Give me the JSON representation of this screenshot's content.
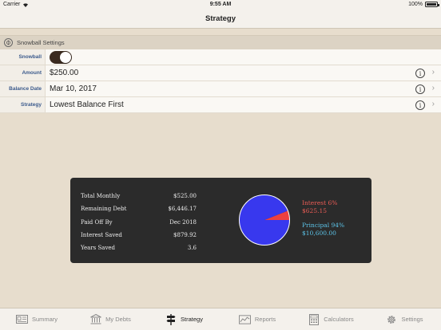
{
  "status_bar": {
    "carrier": "Carrier",
    "time": "9:55 AM",
    "battery": "100%"
  },
  "nav": {
    "title": "Strategy"
  },
  "section": {
    "title": "Snowball Settings"
  },
  "settings": {
    "snowball_label": "Snowball",
    "snowball_on": true,
    "amount_label": "Amount",
    "amount_value": "$250.00",
    "balance_date_label": "Balance Date",
    "balance_date_value": "Mar 10, 2017",
    "strategy_label": "Strategy",
    "strategy_value": "Lowest Balance First"
  },
  "summary": {
    "stats": [
      {
        "label": "Total Monthly",
        "value": "$525.00"
      },
      {
        "label": "Remaining Debt",
        "value": "$6,446.17"
      },
      {
        "label": "Paid Off By",
        "value": "Dec 2018"
      },
      {
        "label": "Interest Saved",
        "value": "$879.92"
      },
      {
        "label": "Years Saved",
        "value": "3.6"
      }
    ],
    "legend": {
      "interest_label": "Interest 6%",
      "interest_value": "$625.15",
      "principal_label": "Principal 94%",
      "principal_value": "$10,600.00"
    }
  },
  "chart_data": {
    "type": "pie",
    "slices": [
      {
        "name": "Interest",
        "percent": 6,
        "value": 625.15,
        "color": "#ec4040"
      },
      {
        "name": "Principal",
        "percent": 94,
        "value": 10600.0,
        "color": "#3838ee"
      }
    ]
  },
  "tabs": [
    {
      "label": "Summary",
      "icon": "summary-icon",
      "active": false
    },
    {
      "label": "My Debts",
      "icon": "bank-icon",
      "active": false
    },
    {
      "label": "Strategy",
      "icon": "signpost-icon",
      "active": true
    },
    {
      "label": "Reports",
      "icon": "chart-icon",
      "active": false
    },
    {
      "label": "Calculators",
      "icon": "calculator-icon",
      "active": false
    },
    {
      "label": "Settings",
      "icon": "gear-icon",
      "active": false
    }
  ]
}
